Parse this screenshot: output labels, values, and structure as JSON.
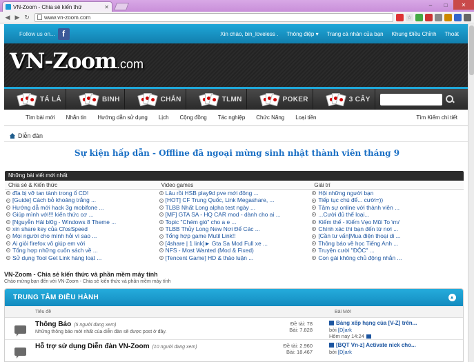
{
  "browser": {
    "tab_title": "VN-Zoom - Chia sẻ kiến thứ",
    "url": "www.vn-zoom.com",
    "window_buttons": [
      "–",
      "□",
      "✕"
    ]
  },
  "topbar": {
    "follow_label": "Follow us on...",
    "links": [
      "Xin chào, bin_loveless .",
      "Thông điệp ▾",
      "Trang cá nhân của bạn",
      "Khung Điều Chỉnh",
      "Thoát"
    ]
  },
  "header": {
    "logo_main": "VN-Zoom",
    "logo_suffix": ".com"
  },
  "games": [
    "TÁ LẢ",
    "BINH",
    "CHẮN",
    "TLMN",
    "POKER",
    "3 CÂY"
  ],
  "menu": {
    "items": [
      "Tìm bài mới",
      "Nhắn tin",
      "Hướng dẫn sử dụng",
      "Lịch",
      "Cộng đồng",
      "Tác nghiệp",
      "Chức Năng",
      "Loại tiền"
    ],
    "right": "Tìm Kiếm chi tiết"
  },
  "breadcrumb": "Diễn đàn",
  "event_banner": "Sự kiện hấp dẫn - Offline đã ngoại mừng sinh nhật thành viên tháng 9",
  "latest": {
    "header": "Những bài viết mới nhất",
    "columns": [
      {
        "title": "Chia sẻ & Kiến thức",
        "posts": [
          "đĩa bị vỡ tan tành trong ổ CD!",
          "[Guide] Cách bỏ khoảng trắng ...",
          "Hướng dẫ mới hack 3g mobifone ...",
          "Giúp mình với!!! kiến thức cơ ...",
          "[Nguyễn Hải bl0g - Windows 8 Theme ...",
          "xin share key của CfosSpeed",
          "Mọi người cho mình hỏi vì sao ...",
          "Ai giỏi firefox vô giúp em với",
          "Tổng hợp những cuốn sách về ...",
          "Sử dụng Tool Get Link hàng loạt ..."
        ]
      },
      {
        "title": "Video games",
        "posts": [
          "Lâu rồi HSB play9d pve mới đông ...",
          "[HOT] CF Trung Quốc, Link Megashare, ...",
          "TLBB Nhất Long alpha test ngày ...",
          "[MF] GTA SA - HQ CAR mod - dành cho ai ...",
          "Topic \"Chém gió\" cho a e ...",
          "TLBB Thủy Long New Nơi Để Các ...",
          "Tổng hợp game Mutil Link!!",
          "[4share | 1 link]► Gta Sa Mod Full xe ...",
          "NFS - Most Wanted (Mod & Fixed)",
          "[Tencent Game] HD & thảo luận ..."
        ]
      },
      {
        "title": "Giải trí",
        "posts": [
          "Hội những người bạn",
          "Tiếp tục chú để... cười=))",
          "Tâm sự online với thành viên ...",
          "...Cười đủ thể loại...",
          "Kiếm thế - Kiếm Vẹo Mũi To \\m/",
          "Chính xác thì bạn đến từ nơi ...",
          "[Cần tư vấn]Mua điện thoại di ...",
          "Thông báo về học Tiếng Anh ...",
          "Truyện cười \"ĐỘC\" ...",
          "Con gái không chủ động nhắn ..."
        ]
      }
    ]
  },
  "forum": {
    "title": "VN-Zoom - Chia sẻ kiến thức và phần mềm máy tính",
    "subtitle": "Chào mừng bạn đến với VN-Zoom - Chia sẻ kiến thức và phần mềm máy tính",
    "section_title": "TRUNG TÂM ĐIỀU HÀNH",
    "col_title": "Tiêu đề",
    "col_last": "Bài Mới",
    "rows": [
      {
        "name": "Thông Báo",
        "viewing": "(5 người đang xem)",
        "desc": "Những thông báo mới nhất của diễn đàn sẽ được post ở đây.",
        "threads": "Đề tài: 78",
        "posts": "Bài: 7.828",
        "last_title": "Bảng xếp hạng của [V-Z] trên...",
        "last_by_label": "bởi",
        "last_by": "[D]ark",
        "last_time": "Hôm nay 14:24"
      },
      {
        "name": "Hỗ trợ sử dụng Diễn đàn VN-Zoom",
        "viewing": "(10 người đang xem)",
        "desc": "",
        "threads": "Đề tài: 2.960",
        "posts": "Bài: 18.467",
        "last_title": "[BQT Vn-z] Activate nick cho...",
        "last_by_label": "bởi",
        "last_by": "[D]ark",
        "last_time": ""
      }
    ]
  }
}
